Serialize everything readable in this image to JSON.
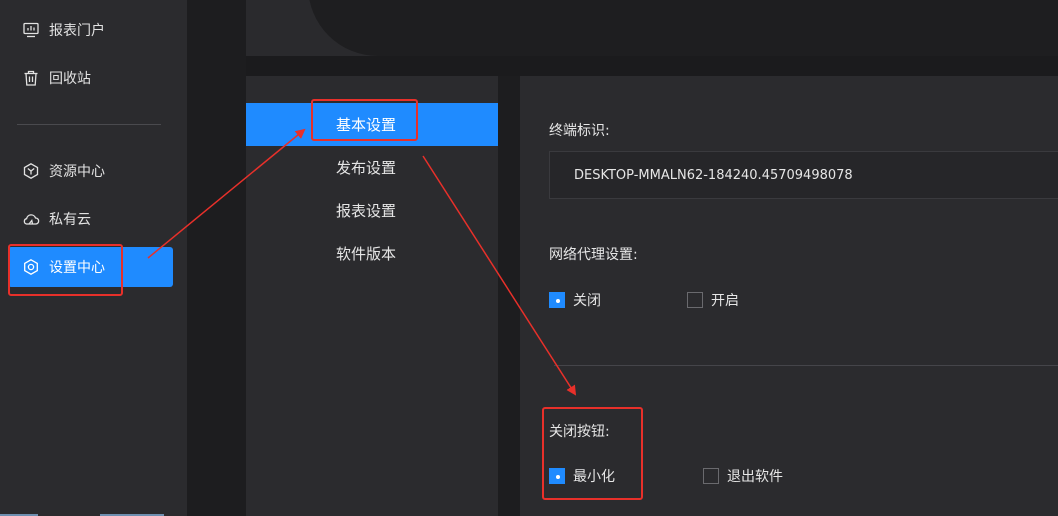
{
  "sidebar": {
    "items": [
      {
        "label": "报表门户",
        "icon": "report-portal-icon"
      },
      {
        "label": "回收站",
        "icon": "trash-icon"
      },
      {
        "label": "资源中心",
        "icon": "resource-center-icon"
      },
      {
        "label": "私有云",
        "icon": "private-cloud-icon"
      },
      {
        "label": "设置中心",
        "icon": "gear-icon",
        "active": true
      }
    ]
  },
  "settings_menu": {
    "items": [
      {
        "label": "基本设置",
        "active": true
      },
      {
        "label": "发布设置"
      },
      {
        "label": "报表设置"
      },
      {
        "label": "软件版本"
      }
    ]
  },
  "basic_settings": {
    "terminal_id_label": "终端标识:",
    "terminal_id_value": "DESKTOP-MMALN62-184240.45709498078",
    "proxy_label": "网络代理设置:",
    "proxy_options": [
      {
        "label": "关闭",
        "checked": true
      },
      {
        "label": "开启",
        "checked": false
      }
    ],
    "close_button_label": "关闭按钮:",
    "close_button_options": [
      {
        "label": "最小化",
        "checked": true
      },
      {
        "label": "退出软件",
        "checked": false
      }
    ]
  },
  "colors": {
    "accent": "#1f8bff",
    "annotation": "#e8302a",
    "panel": "#2b2b2e",
    "background": "#1b1b1d"
  }
}
